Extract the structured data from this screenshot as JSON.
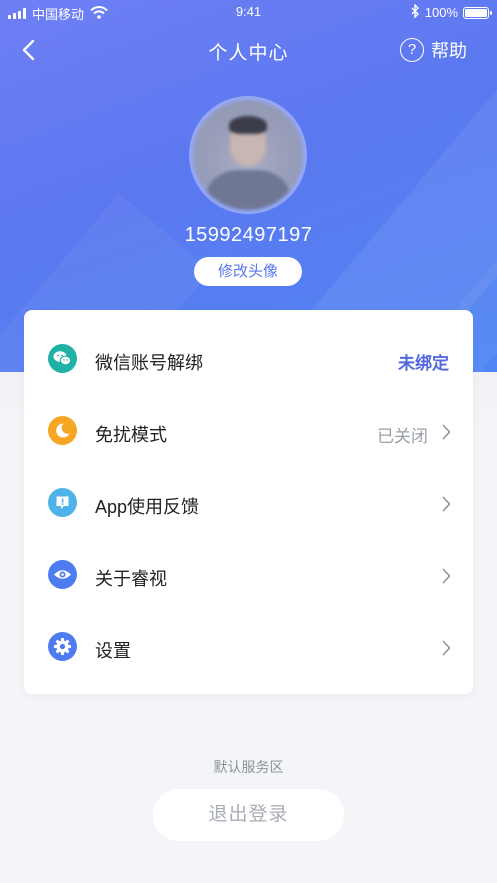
{
  "status_bar": {
    "carrier": "中国移动",
    "time": "9:41",
    "battery_percent": "100%",
    "battery_level": 1.0,
    "icons": [
      "signal-icon",
      "wifi-icon",
      "bluetooth-icon",
      "battery-icon"
    ]
  },
  "nav": {
    "title": "个人中心",
    "help_label": "帮助",
    "back_icon": "chevron-left-icon",
    "help_icon": "question-circle-icon"
  },
  "profile": {
    "phone": "15992497197",
    "edit_avatar_label": "修改头像"
  },
  "menu": {
    "items": [
      {
        "label": "微信账号解绑",
        "value": "未绑定",
        "icon": "wechat-icon",
        "icon_color": "#1fb0a6",
        "value_color": "#5168df"
      },
      {
        "label": "免扰模式",
        "value": "已关闭",
        "icon": "moon-icon",
        "icon_color": "#f5a623"
      },
      {
        "label": "App使用反馈",
        "value": "",
        "icon": "feedback-icon",
        "icon_color": "#4fb3ea"
      },
      {
        "label": "关于睿视",
        "value": "",
        "icon": "eye-icon",
        "icon_color": "#4d7cf0"
      },
      {
        "label": "设置",
        "value": "",
        "icon": "gear-icon",
        "icon_color": "#4d7cf0"
      }
    ]
  },
  "footer": {
    "service_area": "默认服务区",
    "logout_label": "退出登录"
  },
  "colors": {
    "brand": "#5b78f0",
    "accent_text": "#5168df",
    "background": "#f4f5f8"
  }
}
